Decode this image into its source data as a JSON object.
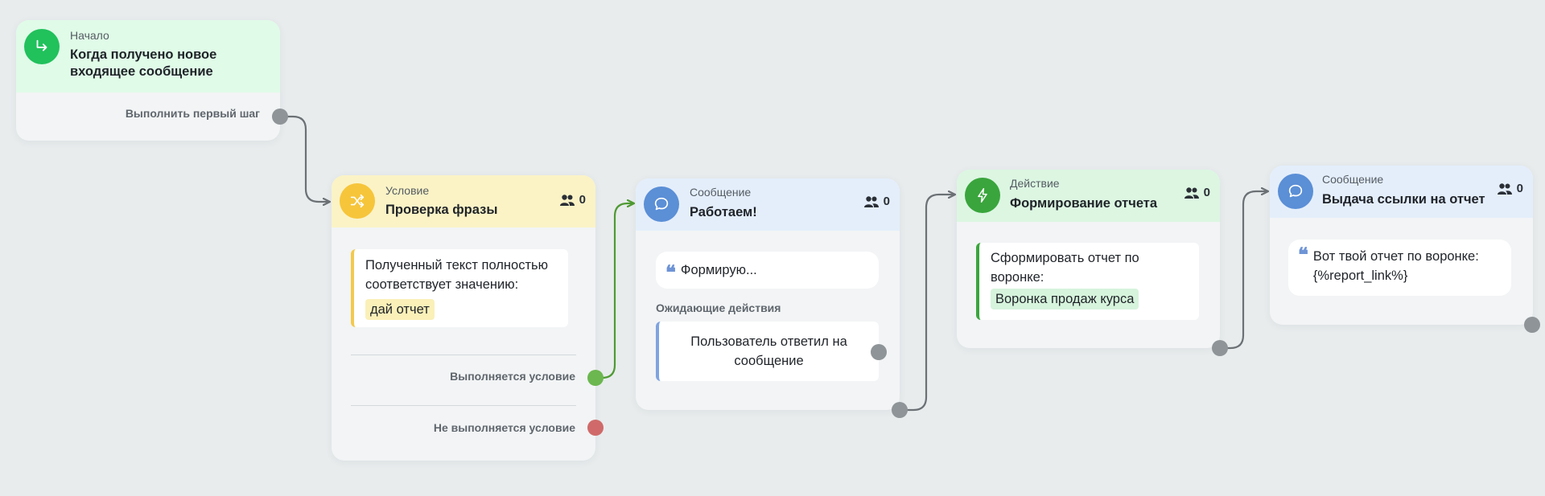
{
  "colors": {
    "canvas_bg": "#e8eced",
    "link_gray": "#6b7175",
    "link_green": "#4f9a33",
    "start_green": "#21c15c",
    "condition_yellow": "#f6c53a",
    "message_blue": "#5b8fd6",
    "action_green": "#3aa53c",
    "port_fail_red": "#d06a6a"
  },
  "nodes": {
    "start": {
      "icon": "enter-arrow-icon",
      "type_label": "Начало",
      "title": "Когда получено новое входящее сообщение",
      "output_label": "Выполнить первый шаг"
    },
    "condition": {
      "icon": "shuffle-icon",
      "type_label": "Условие",
      "title": "Проверка фразы",
      "counter": "0",
      "rule_text": "Полученный текст полностью соответствует значению:",
      "rule_value": "дай отчет",
      "output_true_label": "Выполняется условие",
      "output_false_label": "Не выполняется условие"
    },
    "message1": {
      "icon": "chat-bubble-icon",
      "type_label": "Сообщение",
      "title": "Работаем!",
      "counter": "0",
      "message_text": "Формирую...",
      "pending_label": "Ожидающие действия",
      "pending_action": "Пользователь ответил на сообщение"
    },
    "action": {
      "icon": "lightning-icon",
      "type_label": "Действие",
      "title": "Формирование отчета",
      "counter": "0",
      "action_text": "Сформировать отчет по воронке:",
      "action_value": "Воронка продаж курса"
    },
    "message2": {
      "icon": "chat-bubble-icon",
      "type_label": "Сообщение",
      "title": "Выдача ссылки на отчет",
      "counter": "0",
      "message_text": "Вот твой отчет по воронке: {%report_link%}"
    }
  }
}
